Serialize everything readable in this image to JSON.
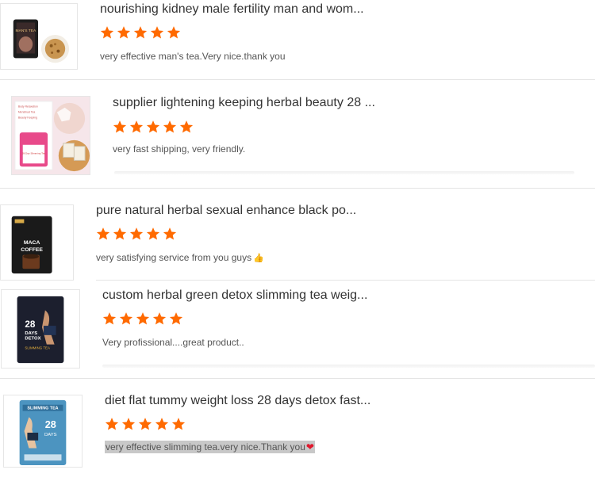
{
  "products": [
    {
      "title": "nourishing kidney male fertility man and wom...",
      "rating": 5,
      "review": "very effective man's tea.Very nice.thank you",
      "review_emoji": ""
    },
    {
      "title": "supplier lightening keeping herbal beauty 28 ...",
      "rating": 5,
      "review": "very fast shipping, very friendly.",
      "review_emoji": ""
    },
    {
      "title": "pure natural herbal sexual enhance black po...",
      "rating": 5,
      "review": "very satisfying service from you guys",
      "review_emoji": "👍"
    },
    {
      "title": "custom herbal green detox slimming tea weig...",
      "rating": 5,
      "review": "Very profissional....great product..",
      "review_emoji": ""
    },
    {
      "title": "diet flat tummy weight loss 28 days detox fast...",
      "rating": 5,
      "review": "very effective slimming tea.very nice.Thank you",
      "review_emoji": "❤"
    }
  ],
  "thumb_text": {
    "p1": "MAN'S TEA",
    "p2": [
      "Body Relaxation",
      "Menstrual Tea",
      "Beauty Keeping",
      "28 Day Slimming Tea"
    ],
    "p3": [
      "MACA",
      "COFFEE"
    ],
    "p4": [
      "28",
      "DAYS",
      "DETOX",
      "SLIMMING TEA"
    ],
    "p5": [
      "SLIMMING TEA",
      "28",
      "DAYS"
    ]
  },
  "colors": {
    "star": "#ff6a00",
    "divider": "#e4e4e4"
  }
}
